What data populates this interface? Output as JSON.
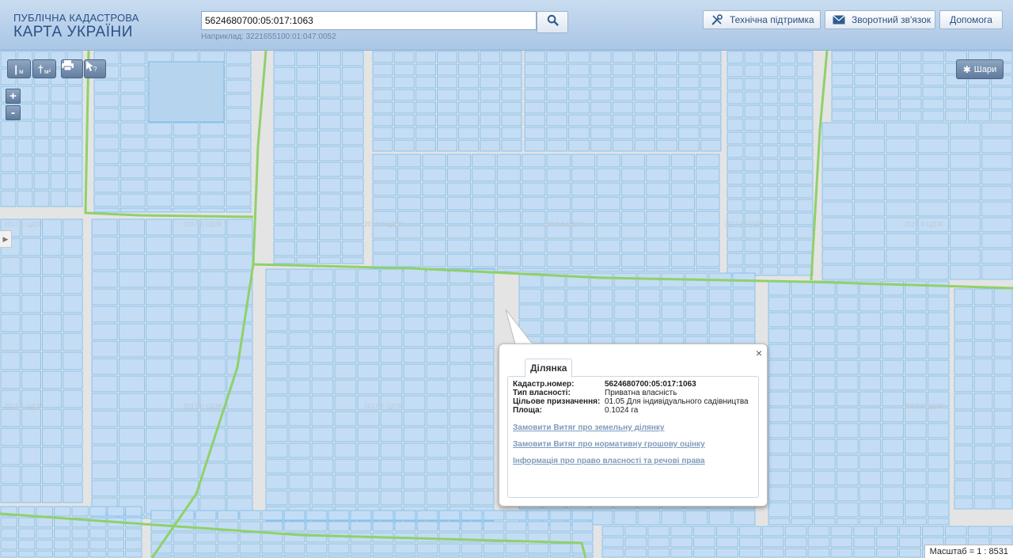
{
  "header": {
    "brand_sub": "ПУБЛІЧНА КАДАСТРОВА",
    "brand_main": "КАРТА УКРАЇНИ",
    "search_value": "5624680700:05:017:1063",
    "search_hint": "Наприклад: 3221655100:01:047:0052",
    "btn_support": "Технічна підтримка",
    "btn_feedback": "Зворотний зв'язок",
    "btn_help": "Допомога"
  },
  "toolbar": {
    "measure_label": "м",
    "area_label": "м²"
  },
  "zoom": {
    "in": "+",
    "out": "-"
  },
  "layers": {
    "label": "Шари"
  },
  "popup": {
    "tab": "Ділянка",
    "close": "×",
    "fields": [
      {
        "key": "Кадастр.номер:",
        "value": "5624680700:05:017:1063"
      },
      {
        "key": "Тип власності:",
        "value": "Приватна власність"
      },
      {
        "key": "Цільове призначення:",
        "value": "01.05 Для індивідуального садівництва"
      },
      {
        "key": "Площа:",
        "value": "0.1024 га"
      }
    ],
    "link_extract": "Замовити Витяг про земельну ділянку",
    "link_valuation": "Замовити Витяг про нормативну грошову оцінку",
    "link_rights": "Інформація про право власності та речові права"
  },
  "scale": {
    "label": "Масштаб = 1 : 8531"
  },
  "watermark": "2017 © ЦДЗК",
  "colors": {
    "parcel_fill": "#c4ddf4",
    "parcel_stroke": "#7cbbe9",
    "road_green": "#8fd16a",
    "header_text": "#2a4f86"
  }
}
